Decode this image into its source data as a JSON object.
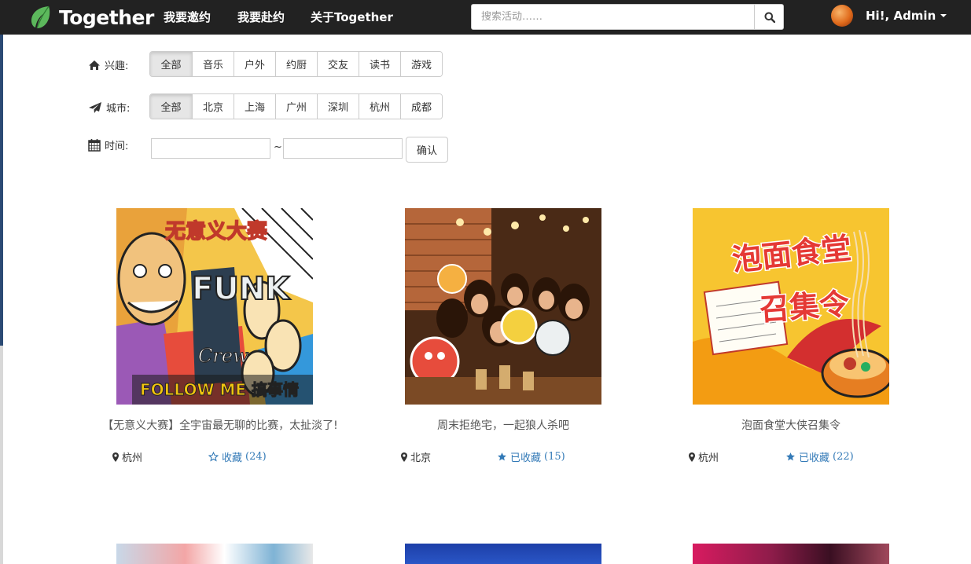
{
  "navbar": {
    "brand": "Together",
    "links": [
      "我要邀约",
      "我要赴约",
      "关于Together"
    ],
    "search_placeholder": "搜索活动……",
    "user_name": "Hi!, Admin"
  },
  "filters": {
    "interest": {
      "label": "兴趣:",
      "options": [
        "全部",
        "音乐",
        "户外",
        "约厨",
        "交友",
        "读书",
        "游戏"
      ],
      "active": "全部"
    },
    "city": {
      "label": "城市:",
      "options": [
        "全部",
        "北京",
        "上海",
        "广州",
        "深圳",
        "杭州",
        "成都"
      ],
      "active": "全部"
    },
    "time": {
      "label": "时间:",
      "separator": "~",
      "start_value": "",
      "end_value": "",
      "confirm": "确认"
    }
  },
  "activities": [
    {
      "title": "【无意义大赛】全宇宙最无聊的比赛，太扯淡了!",
      "city": "杭州",
      "fav_label": "收藏",
      "fav_count": "(24)",
      "favorited": false,
      "image_text": [
        "无意义大赛",
        "FUNK",
        "Crew",
        "FOLLOW ME 搞事情"
      ]
    },
    {
      "title": "周末拒绝宅，一起狼人杀吧",
      "city": "北京",
      "fav_label": "已收藏",
      "fav_count": "(15)",
      "favorited": true,
      "image_text": []
    },
    {
      "title": "泡面食堂大侠召集令",
      "city": "杭州",
      "fav_label": "已收藏",
      "fav_count": "(22)",
      "favorited": true,
      "image_text": [
        "泡面食堂",
        "召集令"
      ]
    }
  ],
  "colors": {
    "navbar": "#222222",
    "link_blue": "#337ab7",
    "accent_green": "#5cb85c"
  },
  "icons": {
    "brand": "leaf-icon",
    "search": "search-icon",
    "interest": "home-icon",
    "city": "paper-plane-icon",
    "time": "calendar-icon",
    "location": "map-marker-icon",
    "favorite_empty": "star-empty-icon",
    "favorite_filled": "star-icon"
  }
}
